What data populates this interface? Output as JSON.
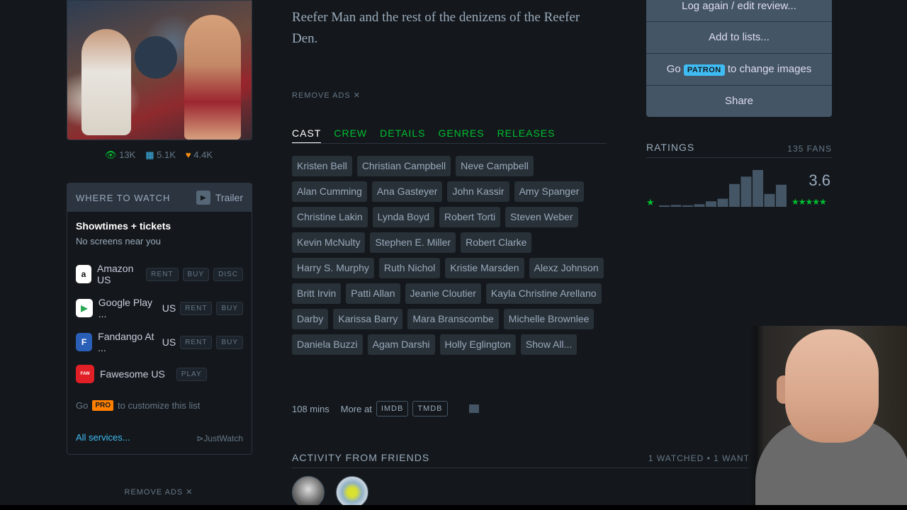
{
  "stats": {
    "watched": "13K",
    "lists": "5.1K",
    "likes": "4.4K"
  },
  "where_to_watch": {
    "title": "WHERE TO WATCH",
    "trailer": "Trailer",
    "showtimes_title": "Showtimes + tickets",
    "showtimes_sub": "No screens near you",
    "services": [
      {
        "name": "Amazon US",
        "tags": [
          "RENT",
          "BUY",
          "DISC"
        ]
      },
      {
        "name": "Google Play ...",
        "region": "US",
        "tags": [
          "RENT",
          "BUY"
        ]
      },
      {
        "name": "Fandango At ...",
        "region": "US",
        "tags": [
          "RENT",
          "BUY"
        ]
      },
      {
        "name": "Fawesome US",
        "tags": [
          "PLAY"
        ]
      }
    ],
    "go_label": "Go",
    "pro_badge": "PRO",
    "customize": "to customize this list",
    "all_services": "All services...",
    "justwatch": "JustWatch"
  },
  "remove_ads_left": "REMOVE ADS ✕",
  "synopsis": "Reefer Man and the rest of the denizens of the Reefer Den.",
  "remove_ads": "REMOVE ADS ✕",
  "tabs": [
    "CAST",
    "CREW",
    "DETAILS",
    "GENRES",
    "RELEASES"
  ],
  "cast": [
    "Kristen Bell",
    "Christian Campbell",
    "Neve Campbell",
    "Alan Cumming",
    "Ana Gasteyer",
    "John Kassir",
    "Amy Spanger",
    "Christine Lakin",
    "Lynda Boyd",
    "Robert Torti",
    "Steven Weber",
    "Kevin McNulty",
    "Stephen E. Miller",
    "Robert Clarke",
    "Harry S. Murphy",
    "Ruth Nichol",
    "Kristie Marsden",
    "Alexz Johnson",
    "Britt Irvin",
    "Patti Allan",
    "Jeanie Cloutier",
    "Kayla Christine Arellano",
    "Darby",
    "Karissa Barry",
    "Mara Branscombe",
    "Michelle Brownlee",
    "Daniela Buzzi",
    "Agam Darshi",
    "Holly Eglington",
    "Show All..."
  ],
  "runtime": "108 mins",
  "more_at": "More at",
  "imdb": "IMDB",
  "tmdb": "TMDB",
  "activity": {
    "title": "ACTIVITY FROM FRIENDS",
    "summary": "1 WATCHED • 1 WANT"
  },
  "actions": {
    "log": "Log again / edit review...",
    "add_lists": "Add to lists...",
    "go": "Go",
    "patron": "PATRON",
    "change_images": "to change images",
    "share": "Share"
  },
  "ratings": {
    "title": "RATINGS",
    "fans": "135 FANS",
    "average": "3.6",
    "histogram": [
      0.03,
      0.05,
      0.04,
      0.07,
      0.15,
      0.22,
      0.62,
      0.82,
      1.0,
      0.35,
      0.6
    ],
    "color": "#445566"
  },
  "colors": {
    "accent_green": "#00c030",
    "accent_blue": "#40bcf4",
    "pro_orange": "#ff8000"
  }
}
